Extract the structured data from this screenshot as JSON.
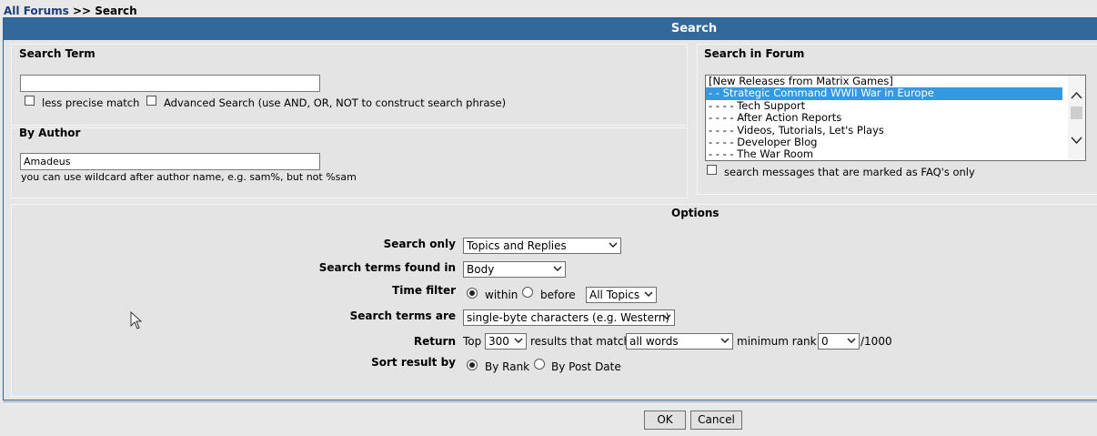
{
  "breadcrumb": {
    "root": "All Forums",
    "separator": ">>",
    "current": "Search"
  },
  "panel": {
    "title": "Search"
  },
  "search_term": {
    "heading": "Search Term",
    "value": "",
    "less_precise_label": "less precise match",
    "advanced_label": "Advanced Search (use AND, OR, NOT to construct search phrase)"
  },
  "author": {
    "heading": "By Author",
    "value": "Amadeus",
    "help": "you can use wildcard after author name, e.g. sam%, but not %sam"
  },
  "forum": {
    "heading": "Search in Forum",
    "items": [
      {
        "label": "[New Releases from Matrix Games]",
        "selected": false
      },
      {
        "label": "- - Strategic Command WWII War in Europe",
        "selected": true
      },
      {
        "label": "- - - - Tech Support",
        "selected": false
      },
      {
        "label": "- - - - After Action Reports",
        "selected": false
      },
      {
        "label": "- - - - Videos, Tutorials, Let's Plays",
        "selected": false
      },
      {
        "label": "- - - - Developer Blog",
        "selected": false
      },
      {
        "label": "- - - - The War Room",
        "selected": false
      }
    ],
    "faq_label": "search messages that are marked as FAQ's only"
  },
  "options": {
    "heading": "Options",
    "search_only": {
      "label": "Search only",
      "value": "Topics and Replies"
    },
    "found_in": {
      "label": "Search terms found in",
      "value": "Body"
    },
    "time_filter": {
      "label": "Time filter",
      "within": "within",
      "before": "before",
      "value": "All Topics"
    },
    "terms_are": {
      "label": "Search terms are",
      "value": "single-byte characters (e.g. Western)"
    },
    "return": {
      "label": "Return",
      "top": "Top",
      "top_value": "300",
      "match_text": "results that match",
      "match_value": "all words",
      "min_rank_text": "minimum rank:",
      "rank_value": "0",
      "rank_suffix": "/1000"
    },
    "sort": {
      "label": "Sort result by",
      "rank": "By Rank",
      "date": "By Post Date"
    }
  },
  "buttons": {
    "ok": "OK",
    "cancel": "Cancel"
  }
}
